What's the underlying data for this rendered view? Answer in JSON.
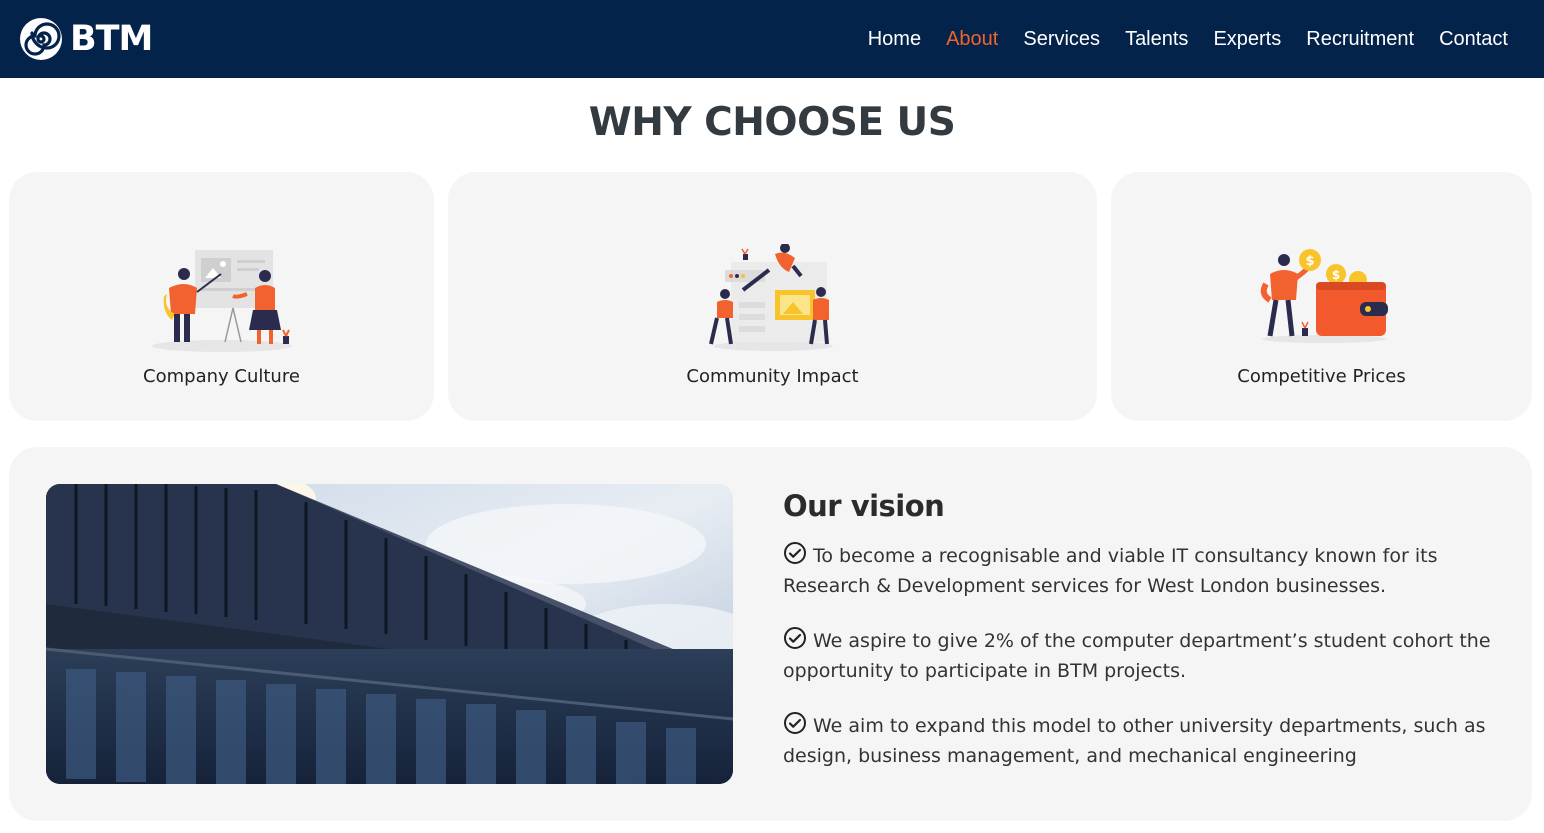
{
  "brand": {
    "name": "BTM",
    "icon": "spiral-logo-icon"
  },
  "nav": {
    "items": [
      {
        "label": "Home",
        "active": false
      },
      {
        "label": "About",
        "active": true
      },
      {
        "label": "Services",
        "active": false
      },
      {
        "label": "Talents",
        "active": false
      },
      {
        "label": "Experts",
        "active": false
      },
      {
        "label": "Recruitment",
        "active": false
      },
      {
        "label": "Contact",
        "active": false
      }
    ]
  },
  "why_choose": {
    "title": "WHY CHOOSE US",
    "cards": [
      {
        "label": "Company Culture",
        "icon": "presentation-illustration"
      },
      {
        "label": "Community Impact",
        "icon": "collaboration-illustration"
      },
      {
        "label": "Competitive Prices",
        "icon": "wallet-coins-illustration"
      }
    ]
  },
  "vision": {
    "title": "Our vision",
    "items": [
      "To become a recognisable and viable IT consultancy known for its Research & Development services for West London businesses.",
      "We aspire to give 2% of the computer department’s student cohort the opportunity to participate in BTM projects.",
      "We aim to expand this model to other university departments, such as design, business management, and mechanical engineering"
    ],
    "bullet_icon": "check-circle-icon"
  },
  "colors": {
    "navbar": "#03234a",
    "accent": "#f2622e",
    "card_bg": "#f5f5f5",
    "text": "#333a40"
  }
}
